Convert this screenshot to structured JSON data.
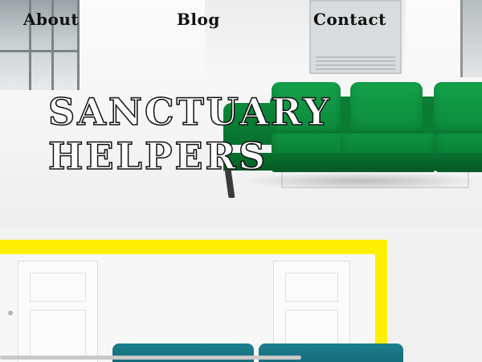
{
  "nav": {
    "about": "About",
    "blog": "Blog",
    "contact": "Contact"
  },
  "hero": {
    "title_line1": "SANCTUARY",
    "title_line2": "HELPERS"
  },
  "colors": {
    "sofa_green": "#0b8a3b",
    "accent_yellow": "#ffef00",
    "teal_sofa": "#1d7f8e"
  }
}
